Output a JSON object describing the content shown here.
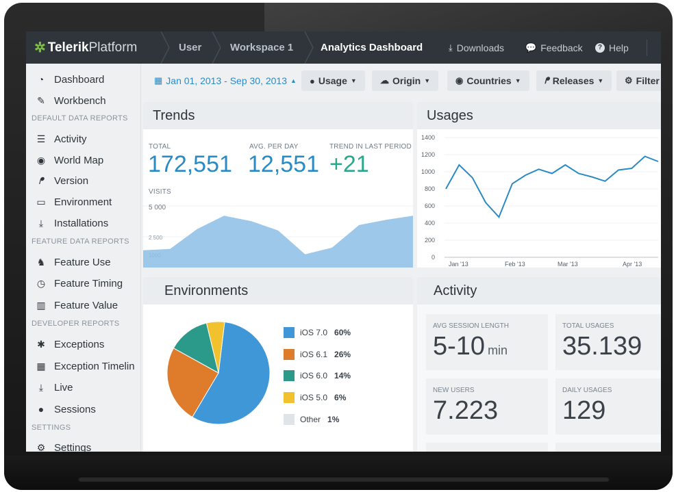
{
  "topbar": {
    "logo_bold": "Telerik",
    "logo_light": "Platform",
    "breadcrumbs": [
      {
        "label": "User"
      },
      {
        "label": "Workspace 1"
      },
      {
        "label": "Analytics Dashboard"
      }
    ],
    "links": [
      {
        "label": "Downloads",
        "icon": "download-icon"
      },
      {
        "label": "Feedback",
        "icon": "comments-icon"
      },
      {
        "label": "Help",
        "icon": "help-icon"
      }
    ]
  },
  "sidebar": {
    "items": [
      {
        "label": "Dashboard",
        "icon": "dashboard-icon"
      },
      {
        "label": "Workbench",
        "icon": "edit-icon"
      },
      {
        "label": "Activity",
        "icon": "list-icon"
      },
      {
        "label": "World Map",
        "icon": "globe-icon"
      },
      {
        "label": "Version",
        "icon": "version-icon"
      },
      {
        "label": "Environment",
        "icon": "monitor-icon"
      },
      {
        "label": "Installations",
        "icon": "download-icon"
      },
      {
        "label": "Feature Use",
        "icon": "feature-icon"
      },
      {
        "label": "Feature Timing",
        "icon": "clock-icon"
      },
      {
        "label": "Feature Value",
        "icon": "bar-chart-icon"
      },
      {
        "label": "Exceptions",
        "icon": "bug-icon"
      },
      {
        "label": "Exception Timelin",
        "icon": "calendar-icon"
      },
      {
        "label": "Live",
        "icon": "download-icon"
      },
      {
        "label": "Sessions",
        "icon": "user-icon"
      },
      {
        "label": "Settings",
        "icon": "gear-icon"
      }
    ],
    "sections": [
      {
        "label": "DEFAULT DATA REPORTS"
      },
      {
        "label": "FEATURE DATA REPORTS"
      },
      {
        "label": "DEVELOPER REPORTS"
      },
      {
        "label": "SETTINGS"
      }
    ]
  },
  "filters": {
    "date_range": "Jan 01, 2013 - Sep 30, 2013",
    "items": [
      {
        "label": "Usage",
        "icon": "user-icon"
      },
      {
        "label": "Origin",
        "icon": "cloud-icon"
      },
      {
        "label": "Countries",
        "icon": "globe-icon"
      },
      {
        "label": "Releases",
        "icon": "version-icon"
      },
      {
        "label": "Filter",
        "icon": "gears-icon"
      }
    ]
  },
  "trends": {
    "title": "Trends",
    "total_label": "TOTAL",
    "total_value": "172,551",
    "avg_label": "AVG. PER DAY",
    "avg_value": "12,551",
    "trend_label": "TREND IN LAST PERIOD",
    "trend_value": "+21",
    "visits_label": "VISITS",
    "axis_labels": [
      "5 000",
      "2 500",
      "1000"
    ],
    "color": "#9dc8ea"
  },
  "usages": {
    "title": "Usages"
  },
  "environments": {
    "title": "Environments"
  },
  "activity": {
    "title": "Activity",
    "tiles": [
      {
        "label": "AVG SESSION LENGTH",
        "value": "5-10",
        "unit": "min"
      },
      {
        "label": "TOTAL USAGES",
        "value": "35.139"
      },
      {
        "label": "NEW USERS",
        "value": "7.223"
      },
      {
        "label": "DAILY USAGES",
        "value": "129"
      }
    ]
  },
  "chart_data": [
    {
      "type": "area",
      "ylim": [
        0,
        5000
      ],
      "ytick_labels": [
        "5 000",
        "2 500",
        "1000"
      ],
      "values": [
        1300,
        1400,
        2900,
        3900,
        3500,
        2800,
        1000,
        1500,
        3200,
        3600,
        3900
      ],
      "color": "#9dc8ea"
    },
    {
      "type": "line",
      "ylim": [
        0,
        1400
      ],
      "yticks": [
        0,
        200,
        400,
        600,
        800,
        1000,
        1200,
        1400
      ],
      "xtick_labels": [
        "Jan '13",
        "Feb '13",
        "Mar '13",
        "Apr '13"
      ],
      "values": [
        800,
        1080,
        930,
        640,
        470,
        860,
        960,
        1030,
        980,
        1080,
        980,
        940,
        890,
        1020,
        1040,
        1180,
        1120
      ],
      "color": "#2a8ac4"
    },
    {
      "type": "pie",
      "slices": [
        {
          "label": "iOS 7.0",
          "pct": 60,
          "color": "#3f97d8"
        },
        {
          "label": "iOS 6.1",
          "pct": 26,
          "color": "#de7c2c"
        },
        {
          "label": "iOS 6.0",
          "pct": 14,
          "color": "#2c9a8a"
        },
        {
          "label": "iOS 5.0",
          "pct": 6,
          "color": "#f2c12e"
        },
        {
          "label": "Other",
          "pct": 1,
          "color": "#dfe4e8"
        }
      ]
    }
  ]
}
